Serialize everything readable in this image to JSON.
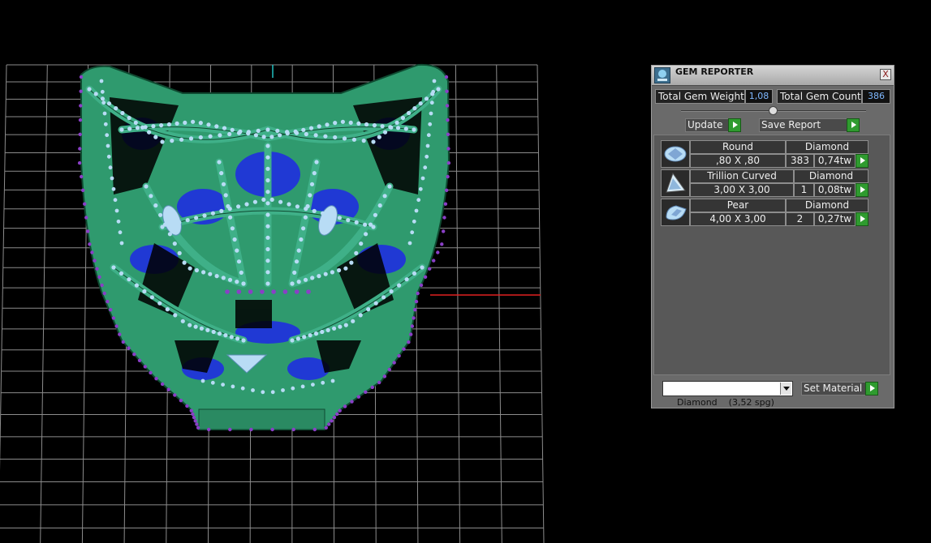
{
  "colors": {
    "grid": "#8c8c8c",
    "model_body": "#2f9a6e",
    "model_wire": "#0f4a31",
    "gem_diamond": "#b8dcf5",
    "gem_amethyst": "#8a3fc7",
    "inner_blue": "#1f2fe0",
    "axis_x": "#e02020",
    "axis_y": "#20c0c0",
    "accent_green": "#2f9b2f"
  },
  "panel": {
    "title": "GEM REPORTER",
    "title_icon": "gem-reporter-icon",
    "close_icon": "close-icon",
    "close_glyph": "X",
    "total_weight_label": "Total Gem Weight",
    "total_weight_value": "1,08",
    "total_count_label": "Total Gem Count",
    "total_count_value": "386",
    "update_label": "Update",
    "save_report_label": "Save Report",
    "gems": [
      {
        "shape": "Round",
        "material": "Diamond",
        "size": ",80 X ,80",
        "count": "383",
        "weight": "0,74tw",
        "icon": "round-gem-icon"
      },
      {
        "shape": "Trillion Curved",
        "material": "Diamond",
        "size": "3,00 X 3,00",
        "count": "1",
        "weight": "0,08tw",
        "icon": "trillion-gem-icon"
      },
      {
        "shape": "Pear",
        "material": "Diamond",
        "size": "4,00 X 3,00",
        "count": "2",
        "weight": "0,27tw",
        "icon": "pear-gem-icon"
      }
    ],
    "material_select": "Diamond    (3,52 spg)",
    "set_material_label": "Set Material"
  }
}
